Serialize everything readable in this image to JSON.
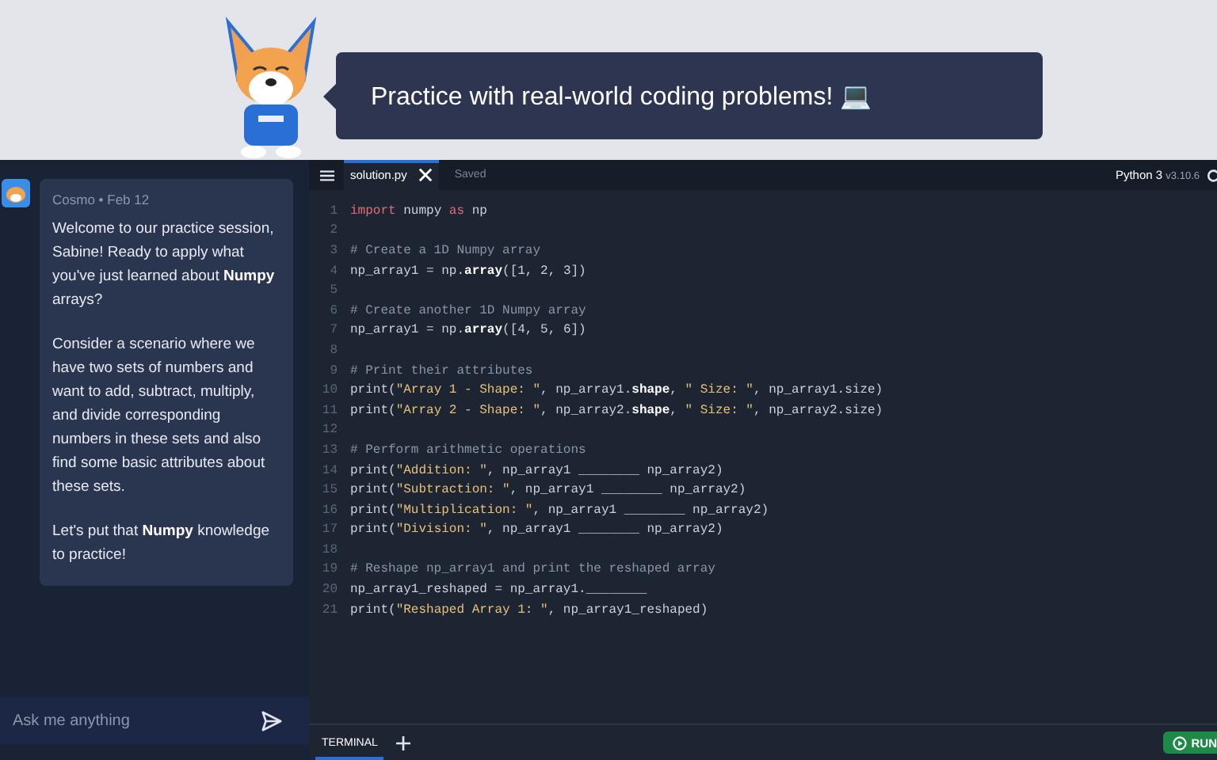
{
  "banner": {
    "text": "Practice with real-world coding problems! 💻"
  },
  "chat": {
    "meta": "Cosmo • Feb 12",
    "paragraphs": [
      "Welcome to our practice session, Sabine! Ready to apply what you've just learned about **Numpy** arrays?",
      "Consider a scenario where we have two sets of numbers and want to add, subtract, multiply, and divide corresponding numbers in these sets and also find some basic attributes about these sets.",
      "Let's put that **Numpy** knowledge to practice!"
    ],
    "input": {
      "placeholder": "Ask me anything"
    }
  },
  "editor": {
    "tabs": [
      {
        "label": "solution.py",
        "selected": true
      }
    ],
    "save_status": "Saved",
    "runtime": "Python 3",
    "version": "v3.10.6",
    "lines": [
      {
        "number": "1",
        "tokens": [
          {
            "kind": "keyword",
            "text": "import"
          },
          {
            "kind": "plain",
            "text": " numpy "
          },
          {
            "kind": "keyword",
            "text": "as"
          },
          {
            "kind": "plain",
            "text": " np"
          }
        ]
      },
      {
        "number": "2"
      },
      {
        "number": "3",
        "tokens": [
          {
            "kind": "comment",
            "text": "# Create a 1D Numpy array"
          }
        ]
      },
      {
        "number": "4",
        "tokens": [
          {
            "kind": "plain",
            "text": "np_array1 = np."
          },
          {
            "kind": "function",
            "text": "array"
          },
          {
            "kind": "plain",
            "text": "([1, 2, 3])"
          }
        ]
      },
      {
        "number": "5"
      },
      {
        "number": "6",
        "tokens": [
          {
            "kind": "comment",
            "text": "# Create another 1D Numpy array"
          }
        ]
      },
      {
        "number": "7",
        "tokens": [
          {
            "kind": "plain",
            "text": "np_array1 = np."
          },
          {
            "kind": "function",
            "text": "array"
          },
          {
            "kind": "plain",
            "text": "([4, 5, 6])"
          }
        ]
      },
      {
        "number": "8"
      },
      {
        "number": "9",
        "tokens": [
          {
            "kind": "comment",
            "text": "# Print their attributes"
          }
        ]
      },
      {
        "number": "10",
        "tokens": [
          {
            "kind": "plain",
            "text": "print("
          },
          {
            "kind": "string",
            "text": "\"Array 1 - Shape: \""
          },
          {
            "kind": "plain",
            "text": ", np_array1."
          },
          {
            "kind": "function",
            "text": "shape"
          },
          {
            "kind": "plain",
            "text": ", "
          },
          {
            "kind": "string",
            "text": "\" Size: \""
          },
          {
            "kind": "plain",
            "text": ", np_array1.size)"
          }
        ]
      },
      {
        "number": "11",
        "tokens": [
          {
            "kind": "plain",
            "text": "print("
          },
          {
            "kind": "string",
            "text": "\"Array 2 - Shape: \""
          },
          {
            "kind": "plain",
            "text": ", np_array2."
          },
          {
            "kind": "function",
            "text": "shape"
          },
          {
            "kind": "plain",
            "text": ", "
          },
          {
            "kind": "string",
            "text": "\" Size: \""
          },
          {
            "kind": "plain",
            "text": ", np_array2.size)"
          }
        ]
      },
      {
        "number": "12"
      },
      {
        "number": "13",
        "tokens": [
          {
            "kind": "comment",
            "text": "# Perform arithmetic operations"
          }
        ]
      },
      {
        "number": "14",
        "tokens": [
          {
            "kind": "plain",
            "text": "print("
          },
          {
            "kind": "string",
            "text": "\"Addition: \""
          },
          {
            "kind": "plain",
            "text": ", np_array1 ________ np_array2)"
          }
        ]
      },
      {
        "number": "15",
        "tokens": [
          {
            "kind": "plain",
            "text": "print("
          },
          {
            "kind": "string",
            "text": "\"Subtraction: \""
          },
          {
            "kind": "plain",
            "text": ", np_array1 ________ np_array2)"
          }
        ]
      },
      {
        "number": "16",
        "tokens": [
          {
            "kind": "plain",
            "text": "print("
          },
          {
            "kind": "string",
            "text": "\"Multiplication: \""
          },
          {
            "kind": "plain",
            "text": ", np_array1 ________ np_array2)"
          }
        ]
      },
      {
        "number": "17",
        "tokens": [
          {
            "kind": "plain",
            "text": "print("
          },
          {
            "kind": "string",
            "text": "\"Division: \""
          },
          {
            "kind": "plain",
            "text": ", np_array1 ________ np_array2)"
          }
        ]
      },
      {
        "number": "18"
      },
      {
        "number": "19",
        "tokens": [
          {
            "kind": "comment",
            "text": "# Reshape np_array1 and print the reshaped array"
          }
        ]
      },
      {
        "number": "20",
        "tokens": [
          {
            "kind": "plain",
            "text": "np_array1_reshaped = np_array1.________"
          }
        ]
      },
      {
        "number": "21",
        "tokens": [
          {
            "kind": "plain",
            "text": "print("
          },
          {
            "kind": "string",
            "text": "\"Reshaped Array 1: \""
          },
          {
            "kind": "plain",
            "text": ", np_array1_reshaped)"
          }
        ]
      }
    ]
  },
  "terminal": {
    "tabs": [
      {
        "label": "TERMINAL",
        "selected": true
      }
    ],
    "run_button": "RUN"
  }
}
